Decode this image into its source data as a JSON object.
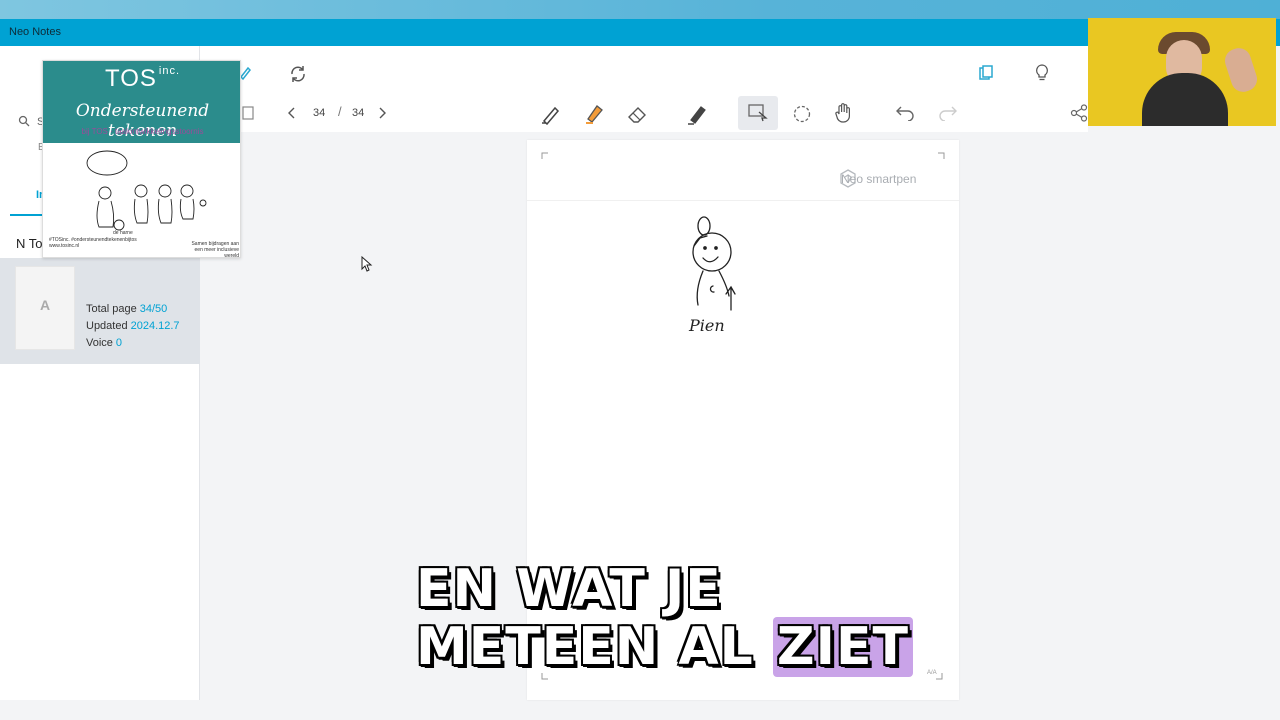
{
  "app": {
    "title": "Neo Notes"
  },
  "sidebar": {
    "search_letter": "S",
    "small_label": "E",
    "tab_label": "In",
    "notebook_name": "N To",
    "notebook": {
      "cover_letter": "A",
      "total_page_label": "Total page",
      "total_page_value": "34/50",
      "updated_label": "Updated",
      "updated_value": "2024.12.7",
      "voice_label": "Voice",
      "voice_value": "0"
    }
  },
  "toolbar": {
    "current_page": "34",
    "separator": "/",
    "total_pages": "34",
    "icons": [
      "edit-icon",
      "sync-icon",
      "copy-icon",
      "lightbulb-icon",
      "page-view-icon",
      "prev-page-icon",
      "next-page-icon",
      "pen-icon",
      "highlighter-icon",
      "eraser-icon",
      "stroke-edit-icon",
      "select-icon",
      "lasso-icon",
      "hand-icon",
      "undo-icon",
      "redo-icon",
      "share-icon"
    ]
  },
  "paper": {
    "brand": "Neo smartpen",
    "handwriting": "Pien",
    "page_mark": "A/A"
  },
  "overlay_card": {
    "title": "TOS",
    "title_suffix": "inc.",
    "subtitle": "Ondersteunend tekenen",
    "tagline": "bij TOS · taalontwikkelingsstoornis",
    "footer_left": "#TOSinc. #ondersteunendtekenenbijtos www.tosinc.nl",
    "footer_right": "Samen bijdragen aan een meer inclusieve wereld",
    "drawing_caption": "de harne"
  },
  "caption": {
    "line1": "EN WAT JE",
    "line2_a": "METEEN AL",
    "line2_highlight": "ZIET"
  },
  "colors": {
    "titlebar": "#00a2d3",
    "accent": "#00a2d3",
    "orange_highlighter": "#f39c3a",
    "card_head": "#2b8c8c",
    "webcam_bg": "#e9c722",
    "caption_highlight": "#c9a3e8"
  }
}
